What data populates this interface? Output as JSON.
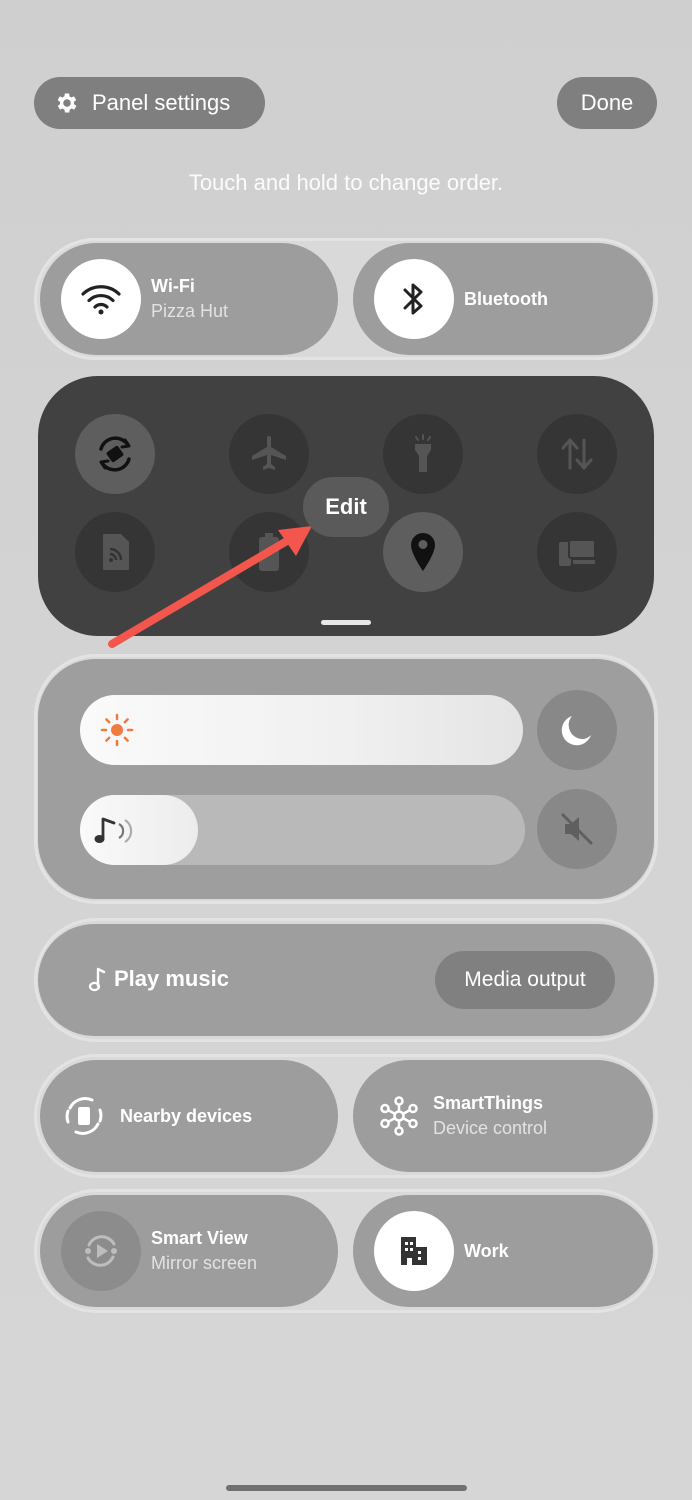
{
  "header": {
    "panel_settings_label": "Panel settings",
    "done_label": "Done",
    "hint": "Touch and hold to change order."
  },
  "tiles": {
    "wifi": {
      "title": "Wi-Fi",
      "subtitle": "Pizza Hut"
    },
    "bluetooth": {
      "title": "Bluetooth"
    },
    "nearby": {
      "title": "Nearby devices"
    },
    "smartthings": {
      "title": "SmartThings",
      "subtitle": "Device control"
    },
    "smartview": {
      "title": "Smart View",
      "subtitle": "Mirror screen"
    },
    "work": {
      "title": "Work"
    }
  },
  "quick_panel": {
    "edit_label": "Edit",
    "buttons": [
      "auto-rotate-icon",
      "airplane-icon",
      "flashlight-icon",
      "mobile-data-icon",
      "nfc-icon",
      "battery-icon",
      "location-icon",
      "device-control-icon"
    ]
  },
  "sliders": {
    "brightness_level": 1.0,
    "volume_level": 0.27
  },
  "media": {
    "play_music_label": "Play music",
    "media_output_label": "Media output"
  },
  "colors": {
    "annotation_arrow": "#f2564c",
    "brightness_icon": "#f07b3f"
  }
}
